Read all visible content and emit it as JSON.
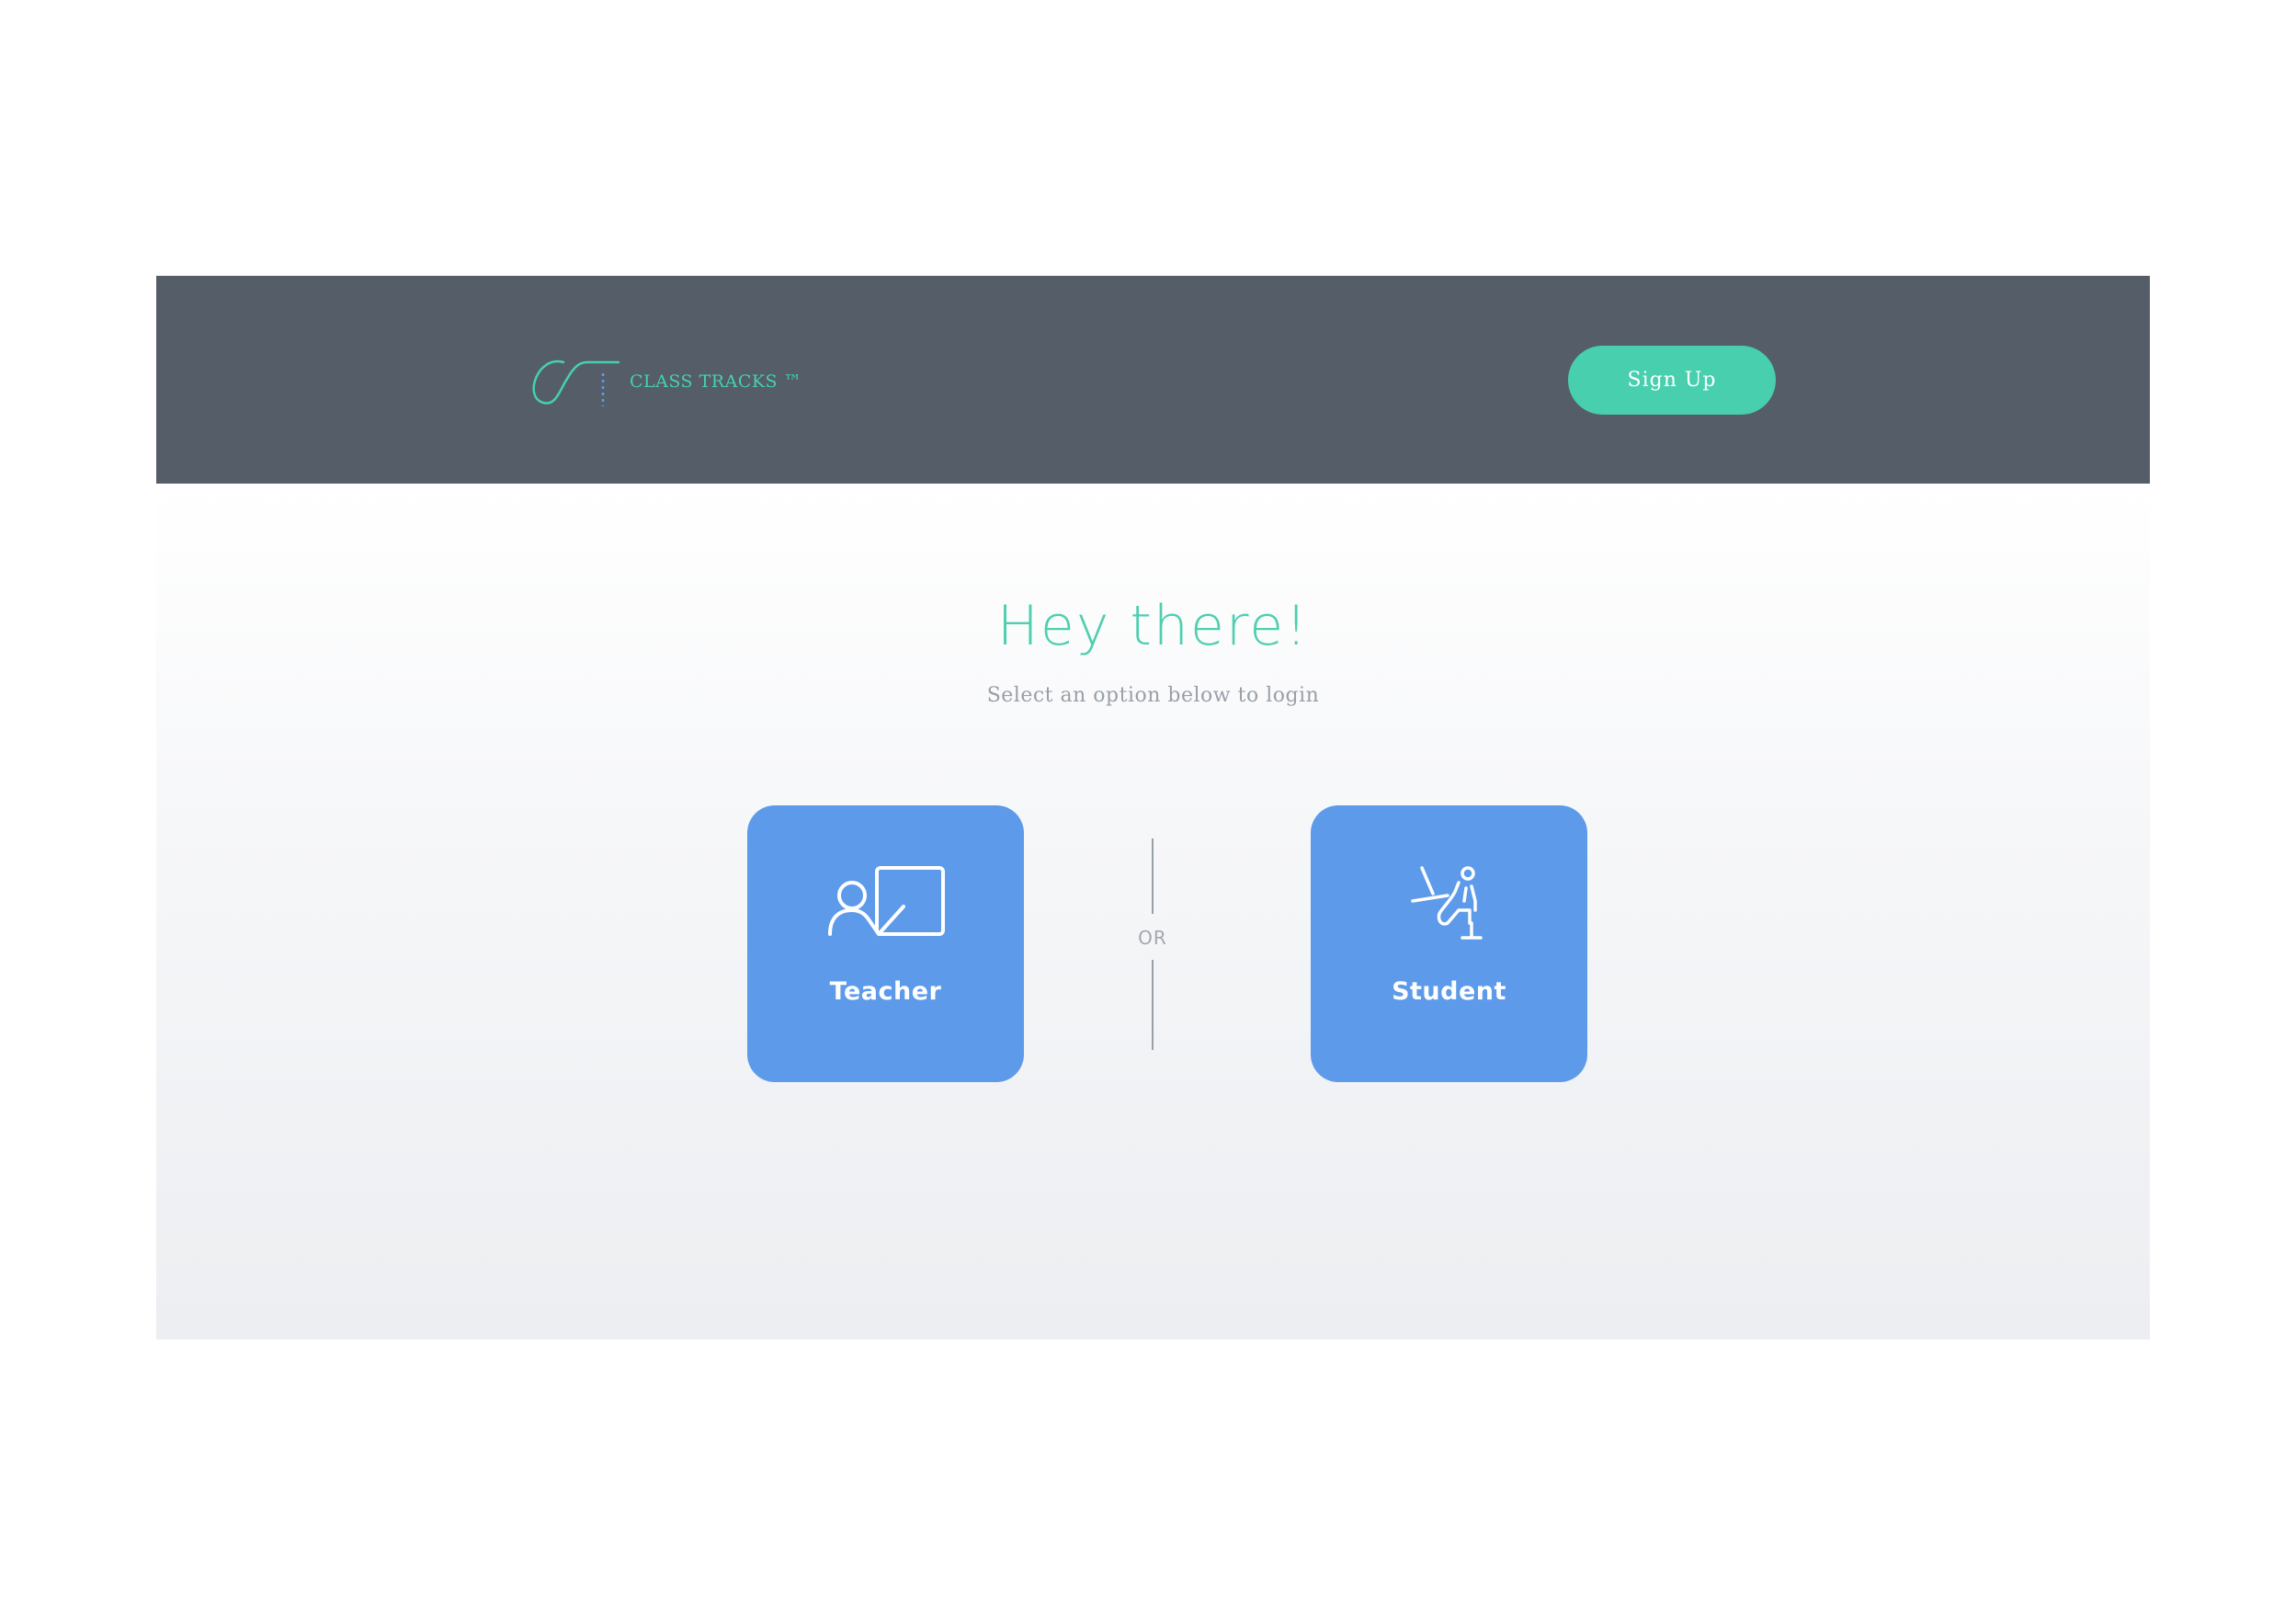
{
  "header": {
    "logo_text": "CLASS TRACKS ™",
    "signup_label": "Sign Up"
  },
  "main": {
    "title": "Hey there!",
    "subtitle": "Select an option below to login",
    "divider_text": "OR",
    "options": [
      {
        "label": "Teacher",
        "icon": "teacher-chalkboard-icon"
      },
      {
        "label": "Student",
        "icon": "student-desk-icon"
      }
    ]
  },
  "colors": {
    "header_bg": "#555d68",
    "accent": "#47cfae",
    "card_bg": "#5d9bea",
    "subtitle": "#9aa0a8"
  }
}
